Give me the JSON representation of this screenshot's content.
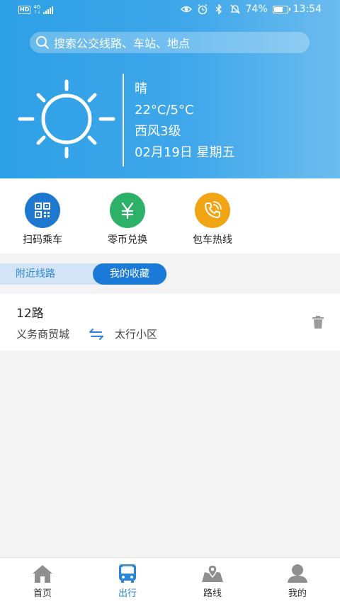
{
  "status_bar": {
    "hd": "HD",
    "network": "4G",
    "battery": "74%",
    "battery_level": 0.74,
    "time": "13:54"
  },
  "search": {
    "placeholder": "搜索公交线路、车站、地点"
  },
  "weather": {
    "condition": "晴",
    "temperature": "22°C/5°C",
    "wind": "西风3级",
    "date": "02月19日 星期五",
    "icon": "sun-icon"
  },
  "quick_actions": [
    {
      "label": "扫码乘车",
      "icon": "qr-code-icon",
      "color": "#1e78d0"
    },
    {
      "label": "零币兑换",
      "icon": "yuan-icon",
      "color": "#2db067"
    },
    {
      "label": "包车热线",
      "icon": "phone-icon",
      "color": "#f1a515"
    }
  ],
  "tabs": {
    "nearby": "附近线路",
    "favorites": "我的收藏",
    "active": "favorites"
  },
  "favorites": [
    {
      "route": "12路",
      "from": "义务商贸城",
      "to": "太行小区"
    }
  ],
  "bottom_nav": [
    {
      "label": "首页",
      "icon": "home-icon"
    },
    {
      "label": "出行",
      "icon": "bus-icon",
      "active": true
    },
    {
      "label": "路线",
      "icon": "map-icon"
    },
    {
      "label": "我的",
      "icon": "user-icon"
    }
  ],
  "colors": {
    "primary": "#2a86d8",
    "hero_start": "#2ea0e6",
    "hero_end": "#6cbcee",
    "tab_active": "#1b7ad8"
  }
}
